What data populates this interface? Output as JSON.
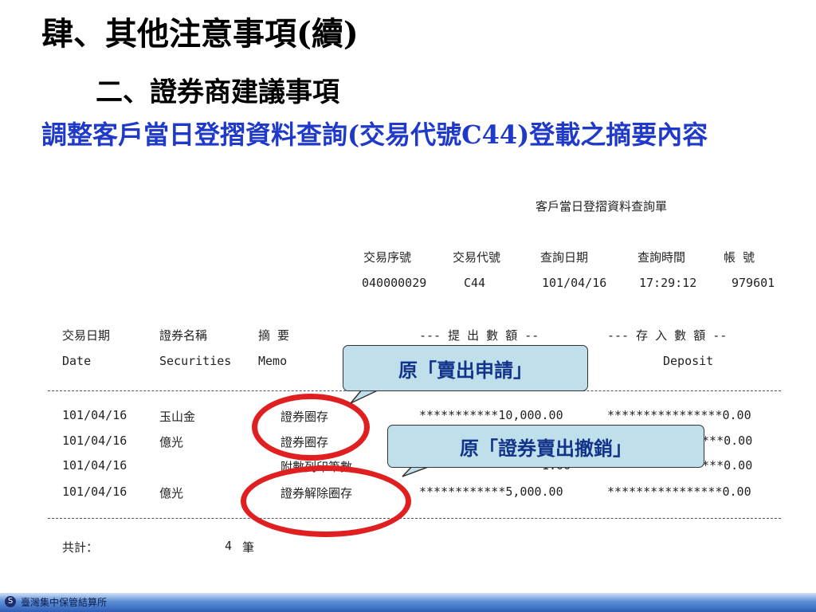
{
  "slide": {
    "title": "肆、其他注意事項(續)",
    "subtitle": "二、證券商建議事項",
    "topic": "調整客戶當日登摺資料查詢(交易代號C44)登載之摘要內容"
  },
  "report": {
    "heading": "客戶當日登摺資料查詢單",
    "meta_headers": [
      "交易序號",
      "交易代號",
      "查詢日期",
      "查詢時間",
      "帳 號"
    ],
    "meta_values": [
      "040000029",
      "C44",
      "101/04/16",
      "17:29:12",
      "979601"
    ],
    "col_headers_zh": [
      "交易日期",
      "證券名稱",
      "摘 要",
      "--- 提 出 數 額 --",
      "--- 存 入 數 額 --"
    ],
    "col_headers_en": [
      "Date",
      "Securities",
      "Memo",
      "Deposit"
    ],
    "rows": [
      {
        "date": "101/04/16",
        "security": "玉山金",
        "memo": "證券圈存",
        "withdraw": "***********10,000.00",
        "deposit": "****************0.00"
      },
      {
        "date": "101/04/16",
        "security": "億光",
        "memo": "證券圈存",
        "withdraw": "",
        "deposit": "****0.00"
      },
      {
        "date": "101/04/16",
        "security": "",
        "memo": "附數列印筆數",
        "withdraw": "1.00",
        "deposit": "****0.00"
      },
      {
        "date": "101/04/16",
        "security": "億光",
        "memo": "證券解除圈存",
        "withdraw": "************5,000.00",
        "deposit": "****************0.00"
      }
    ],
    "total_label": "共計：",
    "total_count": "4",
    "total_unit": "筆"
  },
  "callouts": {
    "first": "原「賣出申請」",
    "second": "原「證券賣出撤銷」"
  },
  "footer": {
    "organization": "臺灣集中保管結算所",
    "logo_glyph": "S"
  },
  "colors": {
    "topic_text": "#1f3ac8",
    "callout_fill": "#bfe0ea",
    "ring": "#e02020",
    "footer_bar": "#2f5fb8"
  }
}
